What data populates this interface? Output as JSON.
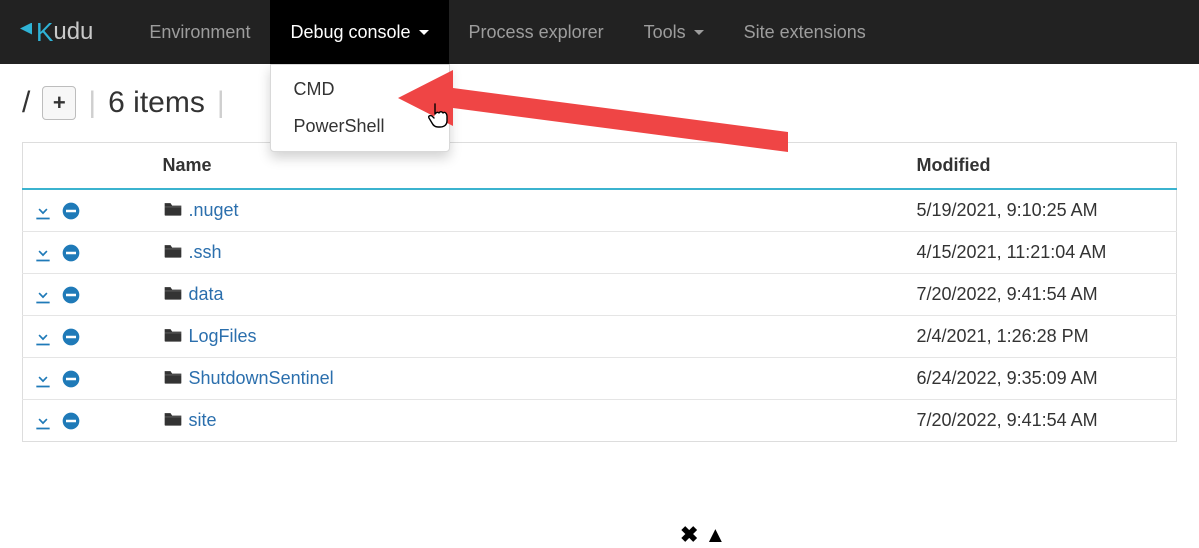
{
  "brand": {
    "rest": "udu"
  },
  "nav": {
    "environment": "Environment",
    "debug_console": "Debug console",
    "process_explorer": "Process explorer",
    "tools": "Tools",
    "site_extensions": "Site extensions",
    "debug_menu": {
      "cmd": "CMD",
      "powershell": "PowerShell"
    }
  },
  "breadcrumb": {
    "root": "/",
    "items_label": "6 items"
  },
  "table": {
    "headers": {
      "name": "Name",
      "modified": "Modified"
    },
    "rows": [
      {
        "name": ".nuget",
        "modified": "5/19/2021, 9:10:25 AM"
      },
      {
        "name": ".ssh",
        "modified": "4/15/2021, 11:21:04 AM"
      },
      {
        "name": "data",
        "modified": "7/20/2022, 9:41:54 AM"
      },
      {
        "name": "LogFiles",
        "modified": "2/4/2021, 1:26:28 PM"
      },
      {
        "name": "ShutdownSentinel",
        "modified": "6/24/2022, 9:35:09 AM"
      },
      {
        "name": "site",
        "modified": "7/20/2022, 9:41:54 AM"
      }
    ]
  }
}
